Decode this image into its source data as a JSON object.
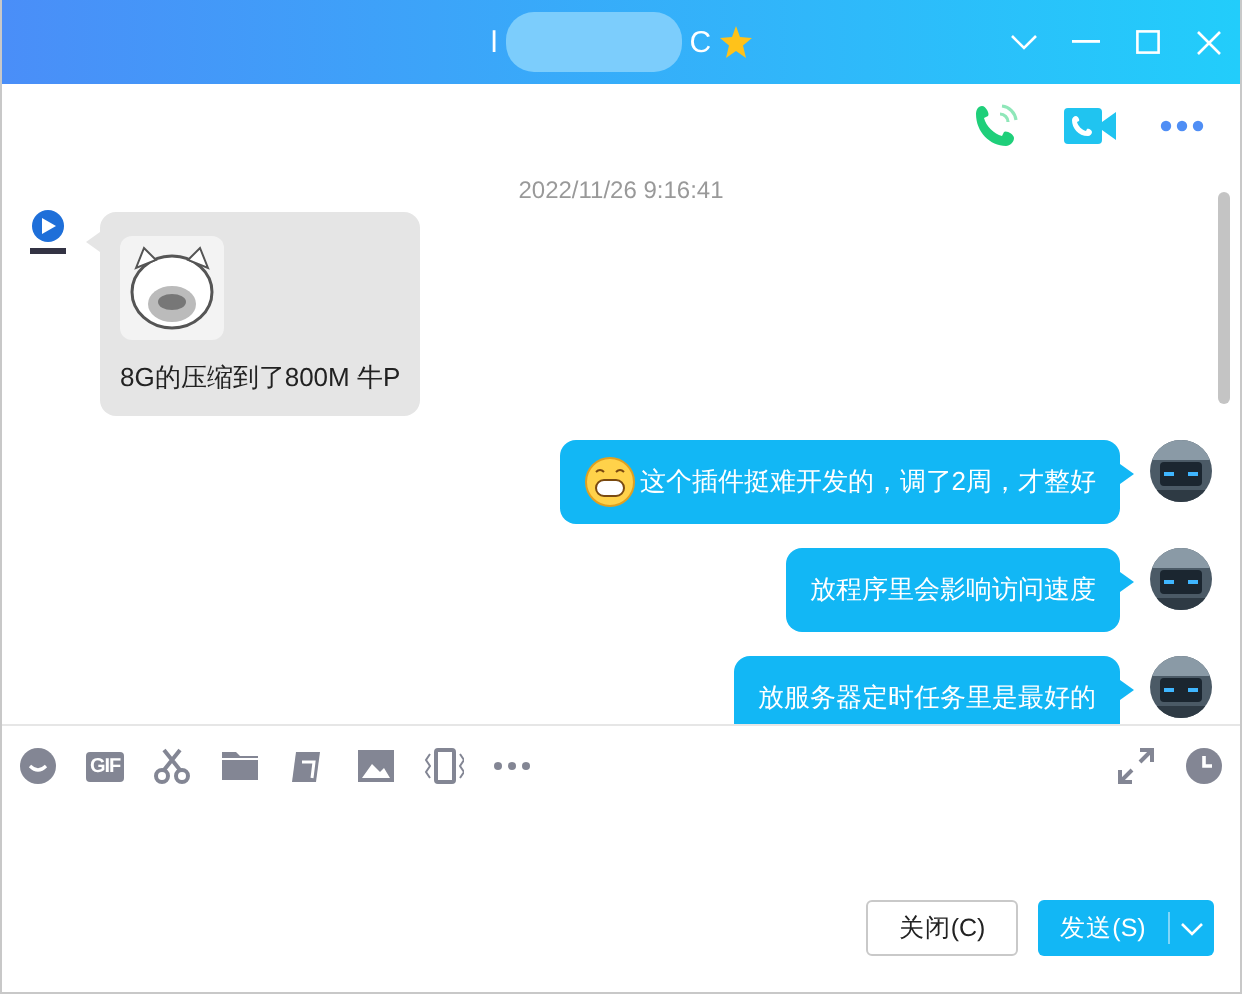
{
  "window": {
    "title_start": "l",
    "title_end": "C"
  },
  "messages": [
    {
      "kind": "incoming",
      "sticker": true,
      "text": "8G的压缩到了800M  牛P"
    },
    {
      "kind": "outgoing",
      "emoji": true,
      "text": "这个插件挺难开发的，调了2周，才整好"
    },
    {
      "kind": "outgoing",
      "emoji": false,
      "text": "放程序里会影响访问速度"
    },
    {
      "kind": "outgoing",
      "emoji": false,
      "text": "放服务器定时任务里是最好的"
    }
  ],
  "timestamp": "2022/11/26 9:16:41",
  "toolbar": {
    "gif_label": "GIF"
  },
  "buttons": {
    "close": "关闭(C)",
    "send": "发送(S)"
  }
}
